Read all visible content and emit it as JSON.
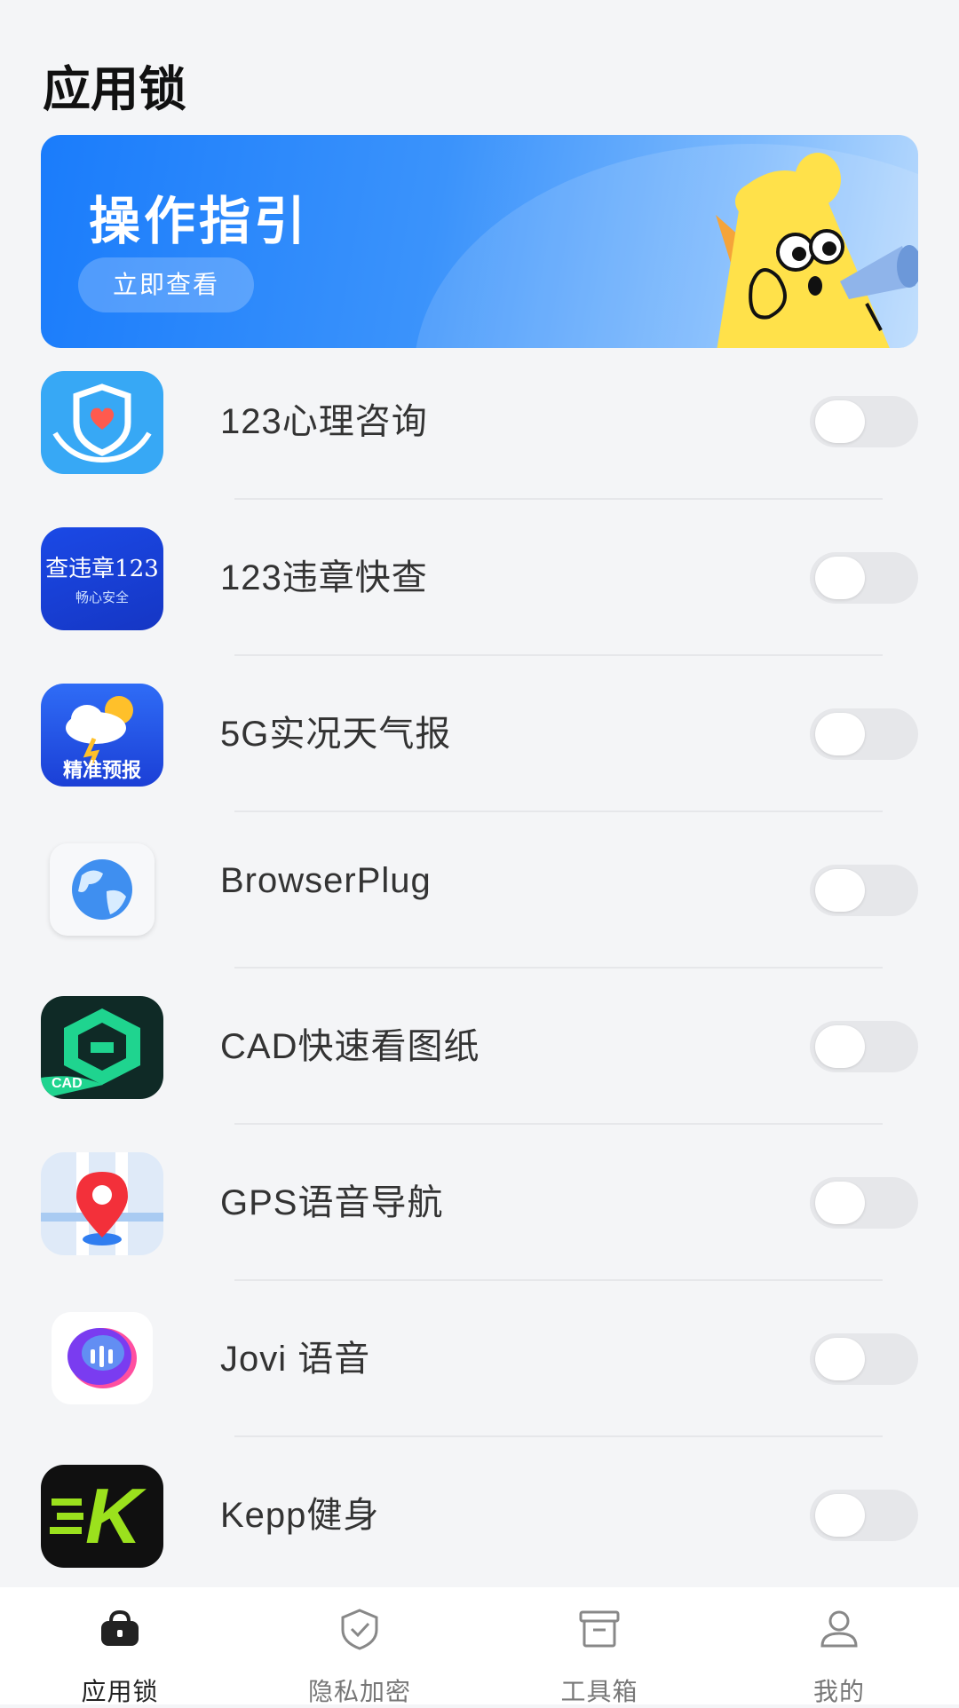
{
  "header": {
    "title": "应用锁"
  },
  "banner": {
    "title": "操作指引",
    "button_label": "立即查看"
  },
  "apps": [
    {
      "name": "123心理咨询",
      "icon": "heart-shield-icon",
      "locked": false
    },
    {
      "name": "123违章快查",
      "icon": "traffic-check-icon",
      "icon_text": "查违章123",
      "icon_subtext": "畅心安全",
      "locked": false
    },
    {
      "name": "5G实况天气报",
      "icon": "weather-icon",
      "icon_text": "精准预报",
      "locked": false
    },
    {
      "name": "BrowserPlug",
      "icon": "globe-icon",
      "locked": false
    },
    {
      "name": "CAD快速看图纸",
      "icon": "cad-icon",
      "icon_text": "CAD",
      "locked": false
    },
    {
      "name": "GPS语音导航",
      "icon": "map-pin-icon",
      "locked": false
    },
    {
      "name": "Jovi 语音",
      "icon": "voice-assistant-icon",
      "locked": false
    },
    {
      "name": "Kepp健身",
      "icon": "fitness-k-icon",
      "icon_text": "K",
      "locked": false
    }
  ],
  "nav": [
    {
      "label": "应用锁",
      "icon": "lock-bag-icon",
      "active": true
    },
    {
      "label": "隐私加密",
      "icon": "shield-check-icon",
      "active": false
    },
    {
      "label": "工具箱",
      "icon": "toolbox-icon",
      "active": false
    },
    {
      "label": "我的",
      "icon": "profile-icon",
      "active": false
    }
  ],
  "colors": {
    "accent": "#1a7cfb",
    "toggle_off": "#e6e7ea",
    "background": "#f4f5f7"
  }
}
